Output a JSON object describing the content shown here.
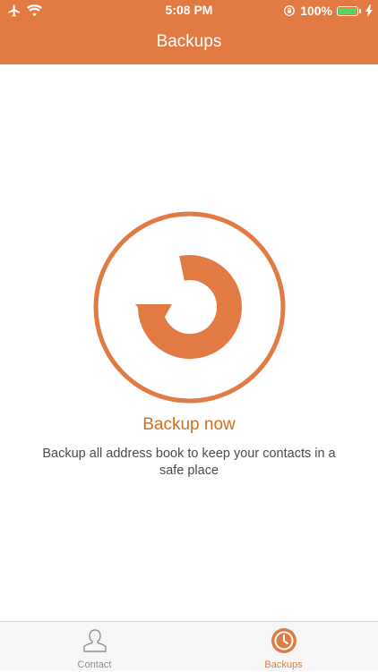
{
  "status_bar": {
    "time": "5:08 PM",
    "battery_text": "100%",
    "battery_level": 1.0,
    "icons": [
      "airplane-icon",
      "wifi-icon",
      "rotation-lock-icon",
      "battery-icon",
      "charging-icon"
    ]
  },
  "nav": {
    "title": "Backups"
  },
  "main": {
    "backup_icon": "backup-refresh-icon",
    "backup_label": "Backup now",
    "description": "Backup all address book to keep your contacts in a safe place"
  },
  "tabs": [
    {
      "label": "Contact",
      "icon": "person-icon",
      "active": false
    },
    {
      "label": "Backups",
      "icon": "clock-icon",
      "active": true
    }
  ],
  "colors": {
    "accent": "#e27a44",
    "label_text": "#cf6f23",
    "body_text": "#4a4a4a",
    "tab_inactive": "#8e8e93",
    "battery_fill": "#4cd964"
  }
}
